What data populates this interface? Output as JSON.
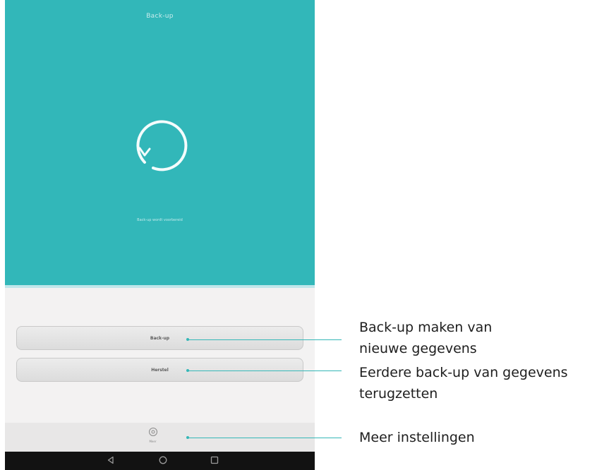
{
  "phone": {
    "app_title": "Back-up",
    "status_text": "Back-up wordt voorbereid",
    "buttons": {
      "backup": "Back-up",
      "restore": "Herstel"
    },
    "settings_label": "Meer",
    "icons": {
      "spinner": "loading-spinner-icon",
      "settings": "gear-icon",
      "nav_back": "back-triangle-icon",
      "nav_home": "home-circle-icon",
      "nav_recent": "recent-apps-square-icon"
    }
  },
  "callouts": {
    "backup": [
      "Back-up maken van",
      "nieuwe gegevens"
    ],
    "restore": [
      "Eerdere back-up van gegevens",
      "terugzetten"
    ],
    "settings": [
      "Meer instellingen"
    ]
  },
  "colors": {
    "teal": "#32b7b9",
    "callout_line": "#35b7b7",
    "navbar": "#121212",
    "panel": "#f3f2f2"
  }
}
